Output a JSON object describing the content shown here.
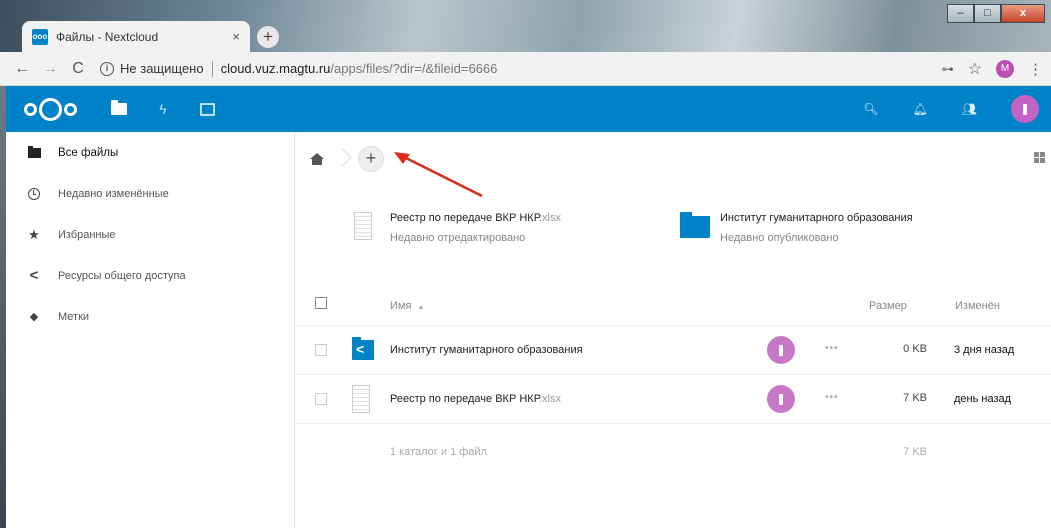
{
  "browser": {
    "tab_title": "Файлы - Nextcloud",
    "tab_favicon": "ooo",
    "tab_close": "×",
    "new_tab": "+",
    "window_controls": {
      "minimize": "–",
      "maximize": "□",
      "close": "x"
    },
    "back": "←",
    "forward": "→",
    "reload": "C",
    "info": "i",
    "security_label": "Не защищено",
    "url_host": "cloud.vuz.magtu.ru",
    "url_path": "/apps/files/?dir=/&fileid=6666",
    "key_icon": "⊶",
    "star_icon": "☆",
    "profile_initial": "M",
    "menu_icon": "⋮"
  },
  "header": {
    "apps": [
      "files-icon",
      "activity-icon",
      "gallery-icon"
    ],
    "bolt": "ϟ",
    "search": "🔍︎",
    "notifications": "🔔︎",
    "contacts": "👥︎"
  },
  "sidebar": {
    "items": [
      {
        "label": "Все файлы",
        "icon": "folder-icon"
      },
      {
        "label": "Недавно изменённые",
        "icon": "clock-icon"
      },
      {
        "label": "Избранные",
        "icon": "star-icon",
        "glyph": "★"
      },
      {
        "label": "Ресурсы общего доступа",
        "icon": "share-icon",
        "glyph": "<"
      },
      {
        "label": "Метки",
        "icon": "tag-icon",
        "glyph": "◆"
      }
    ]
  },
  "main": {
    "add_button": "+",
    "recent": [
      {
        "name": "Реестр по передаче ВКР НКР",
        "ext": ".xlsx",
        "subtitle": "Недавно отредактировано"
      },
      {
        "name": "Институт гуманитарного образования",
        "ext": "",
        "subtitle": "Недавно опубликовано"
      }
    ],
    "columns": {
      "name": "Имя",
      "sort_indicator": "▲",
      "size": "Размер",
      "modified": "Изменён"
    },
    "files": [
      {
        "name": "Институт гуманитарного образования",
        "ext": "",
        "size": "0 KB",
        "modified": "3 дня назад",
        "actions": "•••"
      },
      {
        "name": "Реестр по передаче ВКР НКР",
        "ext": ".xlsx",
        "size": "7 KB",
        "modified": "день назад",
        "actions": "•••"
      }
    ],
    "summary": {
      "text": "1 каталог и 1 файл",
      "size": "7 KB"
    }
  },
  "colors": {
    "nextcloud_blue": "#0082c9",
    "avatar_purple": "#c562c5",
    "annotation_arrow": "#e0281e"
  }
}
